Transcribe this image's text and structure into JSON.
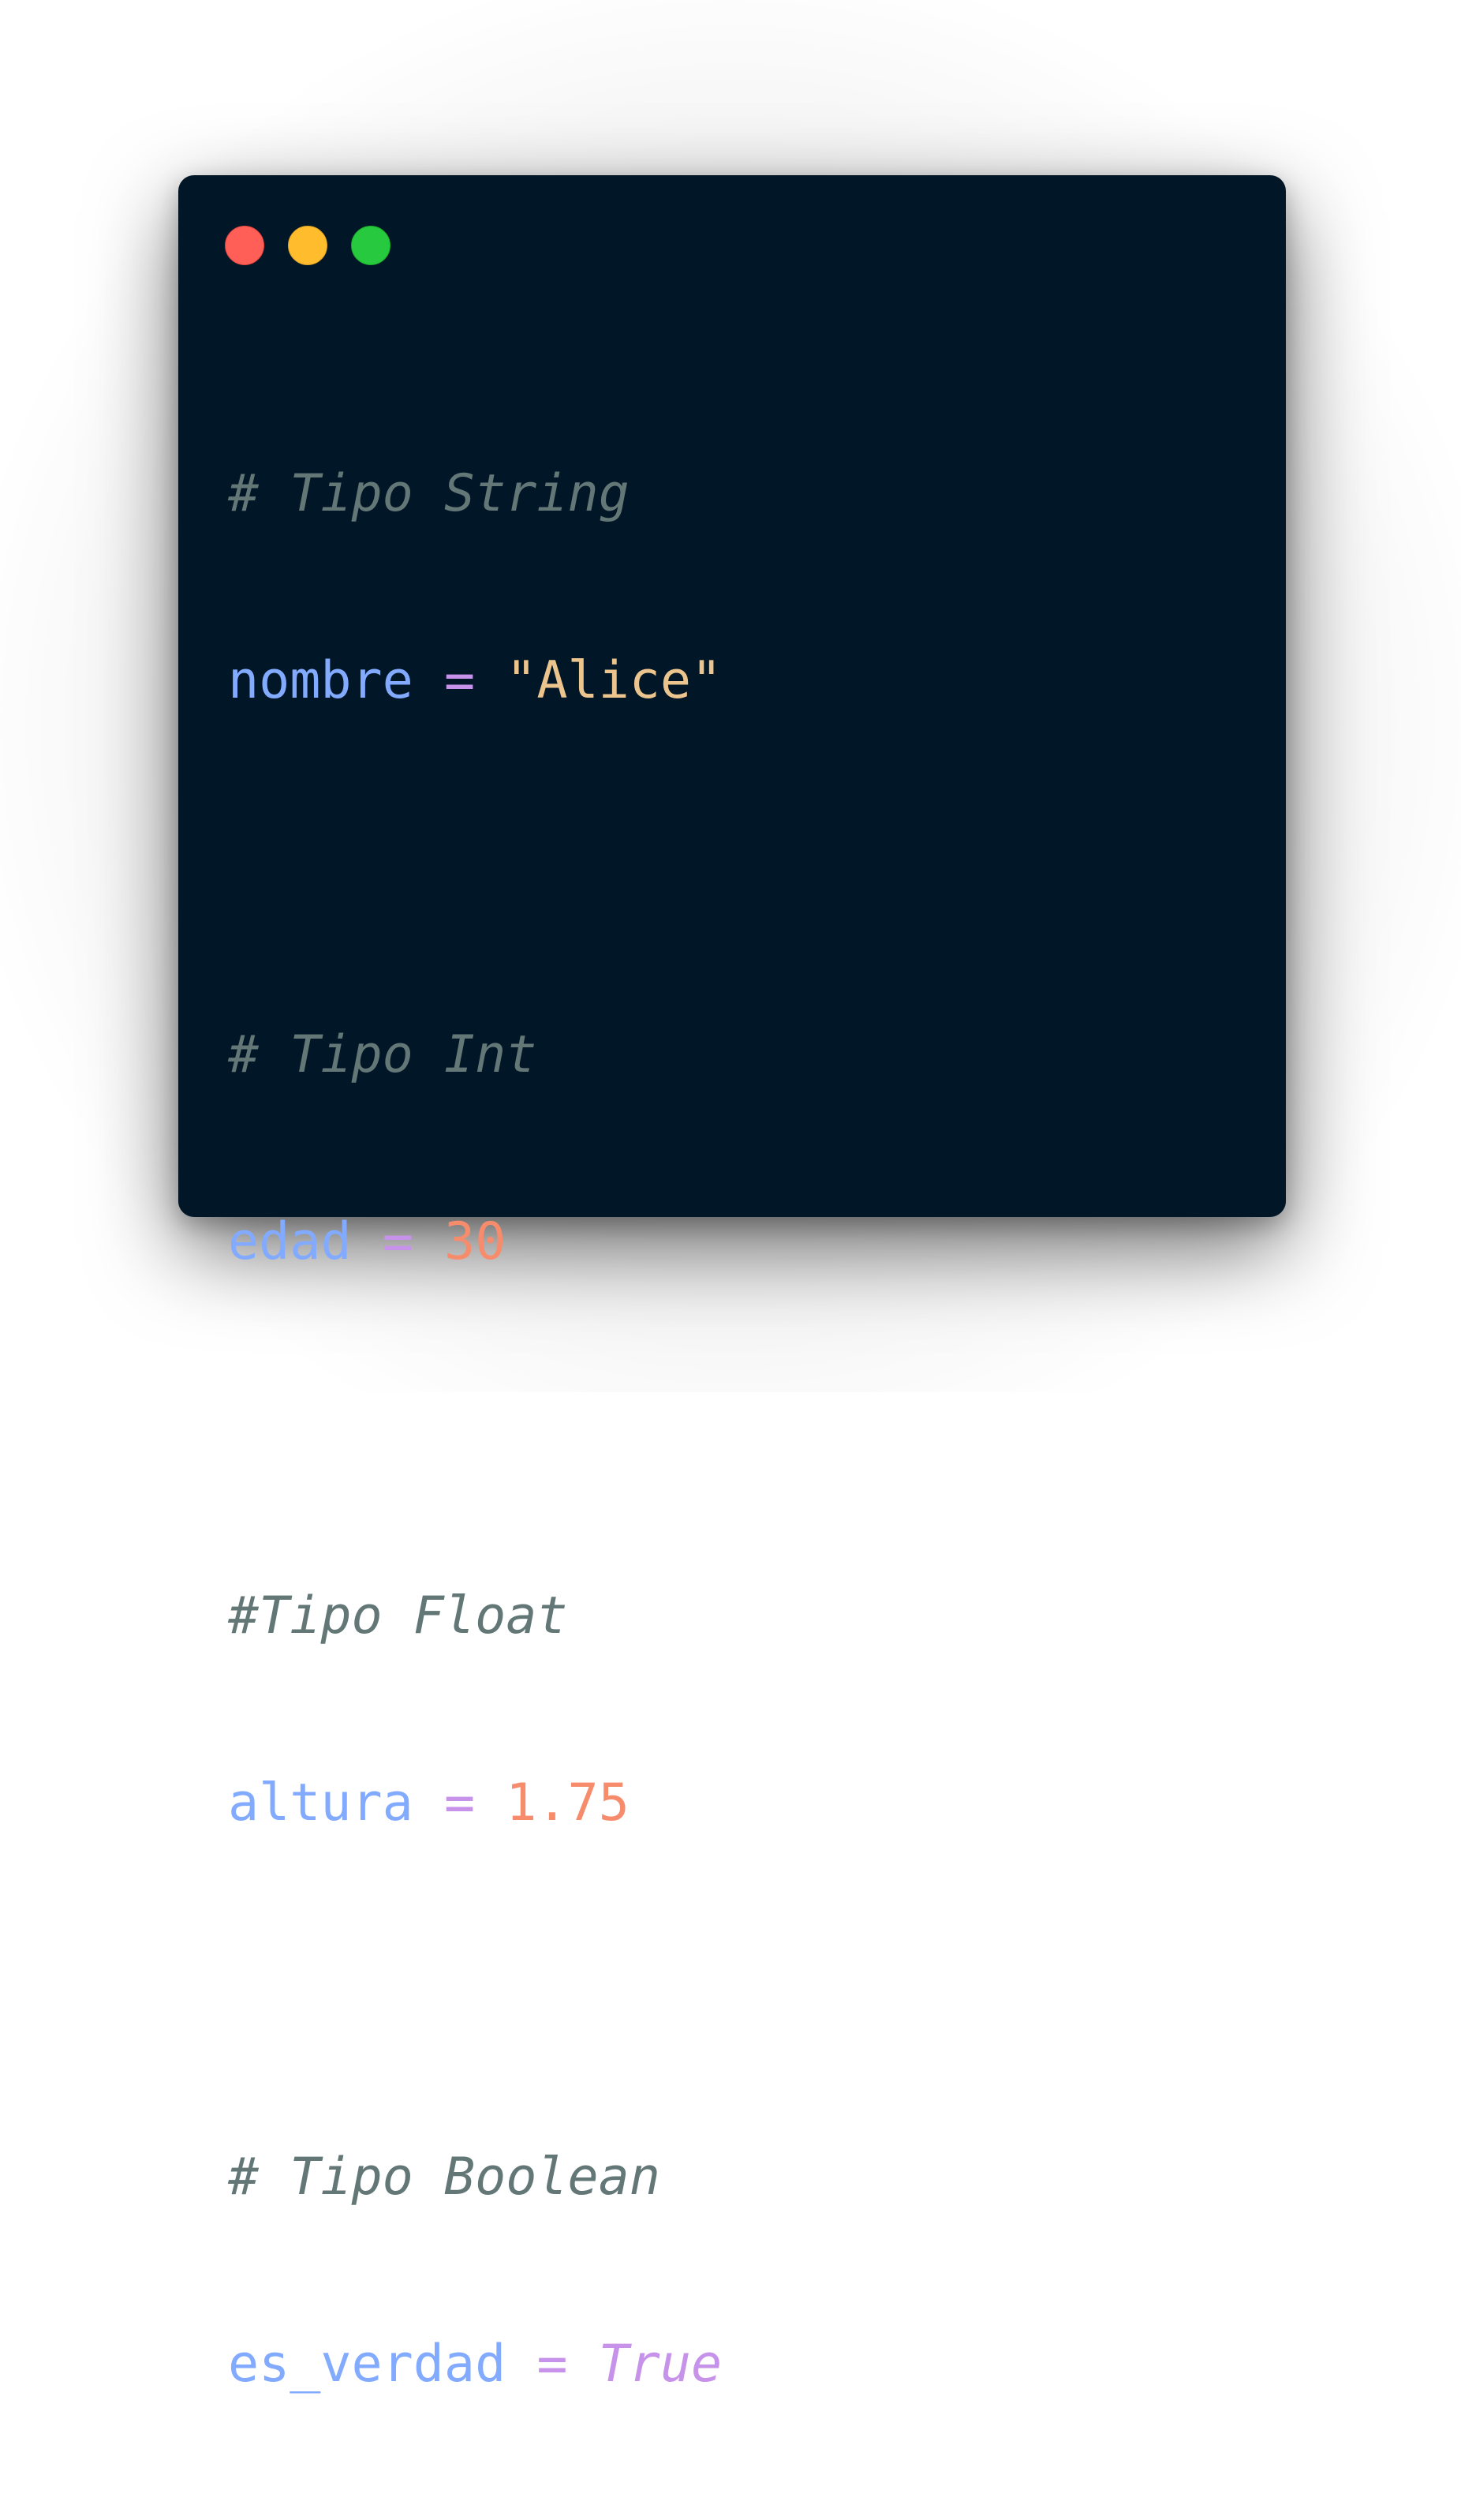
{
  "window": {
    "controls": [
      "close",
      "minimize",
      "maximize"
    ]
  },
  "colors": {
    "background": "#011627",
    "comment": "#637777",
    "variable": "#82aaff",
    "operator": "#c792ea",
    "string": "#ecc48d",
    "number": "#f78c6c",
    "boolean": "#c792ea"
  },
  "code": {
    "block1": {
      "comment": "# Tipo String",
      "var": "nombre",
      "op": "=",
      "value": "\"Alice\""
    },
    "block2": {
      "comment": "# Tipo Int",
      "var": "edad",
      "op": "=",
      "value": "30"
    },
    "block3": {
      "comment": "#Tipo Float",
      "var": "altura",
      "op": "=",
      "value": "1.75"
    },
    "block4": {
      "comment": "# Tipo Boolean",
      "var": "es_verdad",
      "op": "=",
      "value": "True"
    }
  }
}
